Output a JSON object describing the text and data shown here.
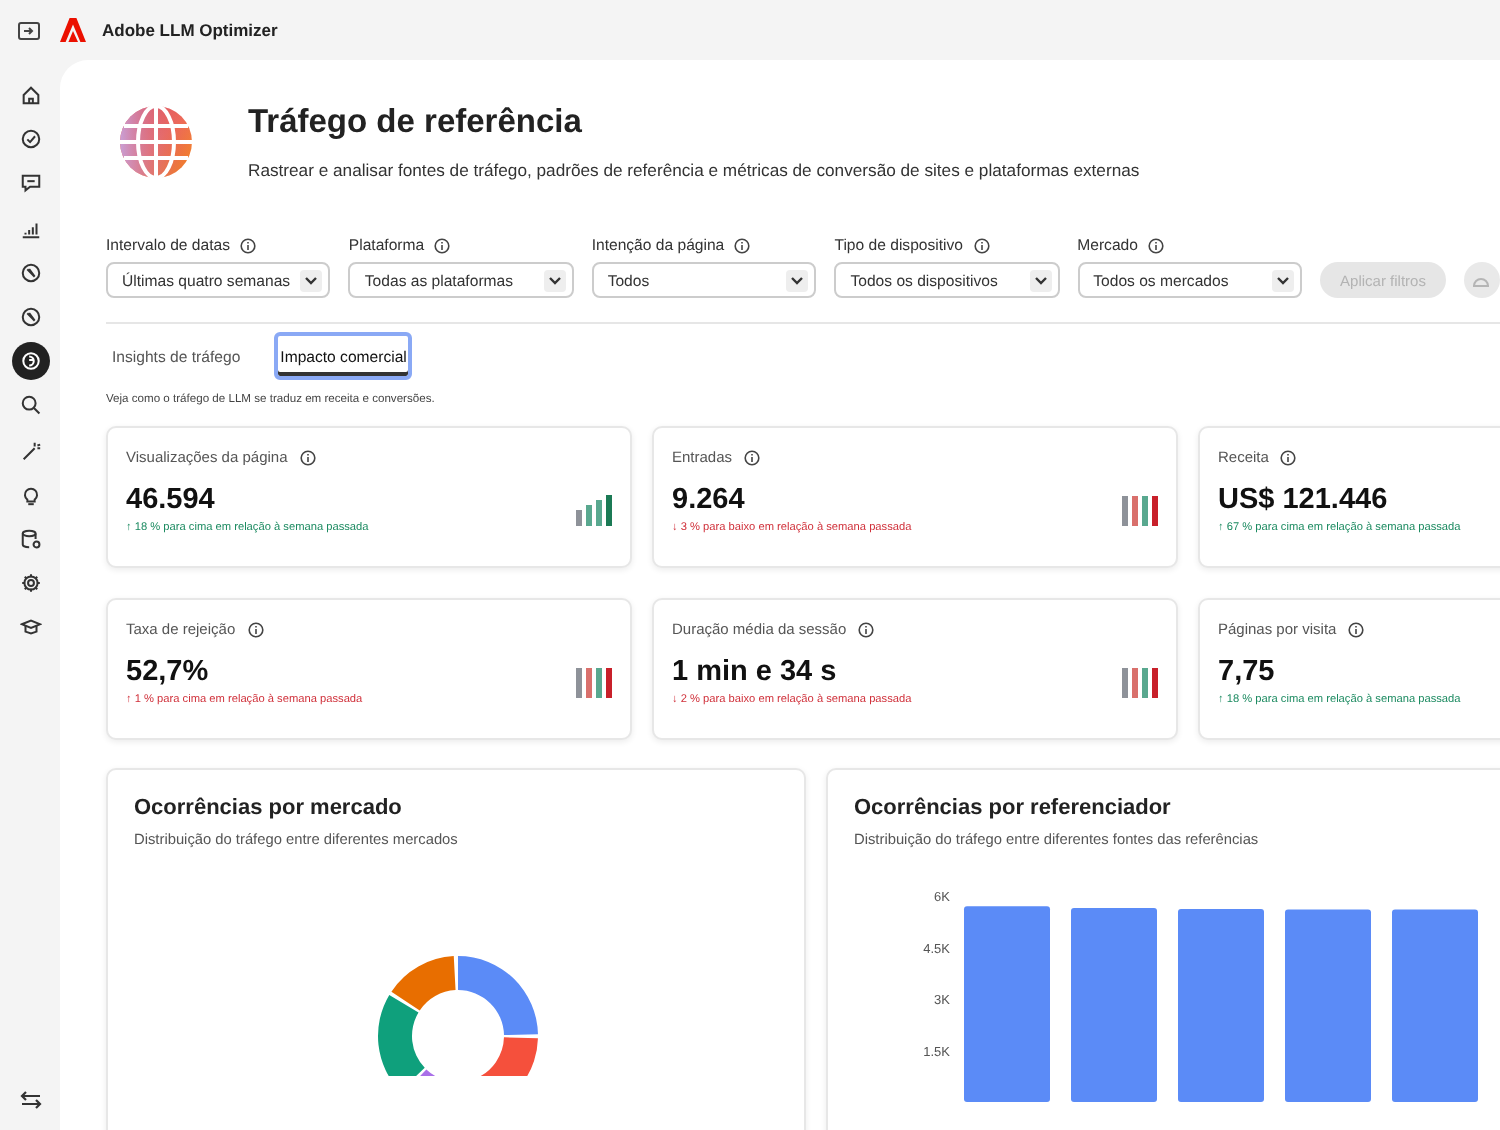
{
  "app": {
    "title": "Adobe LLM Optimizer"
  },
  "sidebar": {
    "items": [
      {
        "selected": false
      },
      {
        "selected": false
      },
      {
        "selected": false
      },
      {
        "selected": false
      },
      {
        "selected": false
      },
      {
        "selected": false
      },
      {
        "selected": true
      },
      {
        "selected": false
      },
      {
        "selected": false
      },
      {
        "selected": false
      },
      {
        "selected": false
      },
      {
        "selected": false
      },
      {
        "selected": false
      }
    ]
  },
  "header": {
    "title": "Tráfego de referência",
    "subtitle": "Rastrear e analisar fontes de tráfego, padrões de referência e métricas de conversão de sites e plataformas externas"
  },
  "filters": [
    {
      "label": "Intervalo de datas",
      "value": "Últimas quatro semanas"
    },
    {
      "label": "Plataforma",
      "value": "Todas as plataformas"
    },
    {
      "label": "Intenção da página",
      "value": "Todos"
    },
    {
      "label": "Tipo de dispositivo",
      "value": "Todos os dispositivos"
    },
    {
      "label": "Mercado",
      "value": "Todos os mercados"
    }
  ],
  "apply_button": {
    "label": "Aplicar filtros",
    "disabled": true
  },
  "reset_button": {
    "disabled": true
  },
  "tabs": [
    {
      "label": "Insights de tráfego",
      "selected": false
    },
    {
      "label": "Impacto comercial",
      "selected": true
    }
  ],
  "tab_description": "Veja como o tráfego de LLM se traduz em receita e conversões.",
  "metrics": [
    {
      "label": "Visualizações da página",
      "value": "46.594",
      "change": "↑ 18 % para cima em relação à semana passada",
      "kind": "positive",
      "trend_bars": true
    },
    {
      "label": "Entradas",
      "value": "9.264",
      "change": "↓ 3 % para baixo em relação à semana passada",
      "kind": "negative",
      "trend_bars": true
    },
    {
      "label": "Receita",
      "value": "US$ 121.446",
      "change": "↑ 67 % para cima em relação à semana passada",
      "kind": "positive",
      "trend_bars": false
    },
    {
      "label": "Taxa de rejeição",
      "value": "52,7%",
      "change": "↑ 1 % para cima em relação à semana passada",
      "kind": "negative",
      "trend_bars": true
    },
    {
      "label": "Duração média da sessão",
      "value": "1 min e 34 s",
      "change": "↓ 2 % para baixo em relação à semana passada",
      "kind": "negative",
      "trend_bars": true
    },
    {
      "label": "Páginas por visita",
      "value": "7,75",
      "change": "↑ 18 % para cima em relação à semana passada",
      "kind": "positive",
      "trend_bars": false
    }
  ],
  "market_chart": {
    "title": "Ocorrências por mercado",
    "subtitle": "Distribuição do tráfego entre diferentes mercados",
    "kind": "picture"
  },
  "referrer_chart": {
    "title": "Ocorrências por referenciador",
    "subtitle": "Distribuição do tráfego entre diferentes fontes das referências",
    "chart_data": {
      "type": "bar",
      "ylim": [
        0,
        6000
      ],
      "yticks": [
        {
          "value": 1500,
          "label": "1.5K"
        },
        {
          "value": 3000,
          "label": "3K"
        },
        {
          "value": 4500,
          "label": "4.5K"
        },
        {
          "value": 6000,
          "label": "6K"
        }
      ],
      "series": [
        {
          "color": "#5b8bf7",
          "values": [
            5700,
            5650,
            5620,
            5610,
            5610
          ]
        }
      ]
    }
  }
}
